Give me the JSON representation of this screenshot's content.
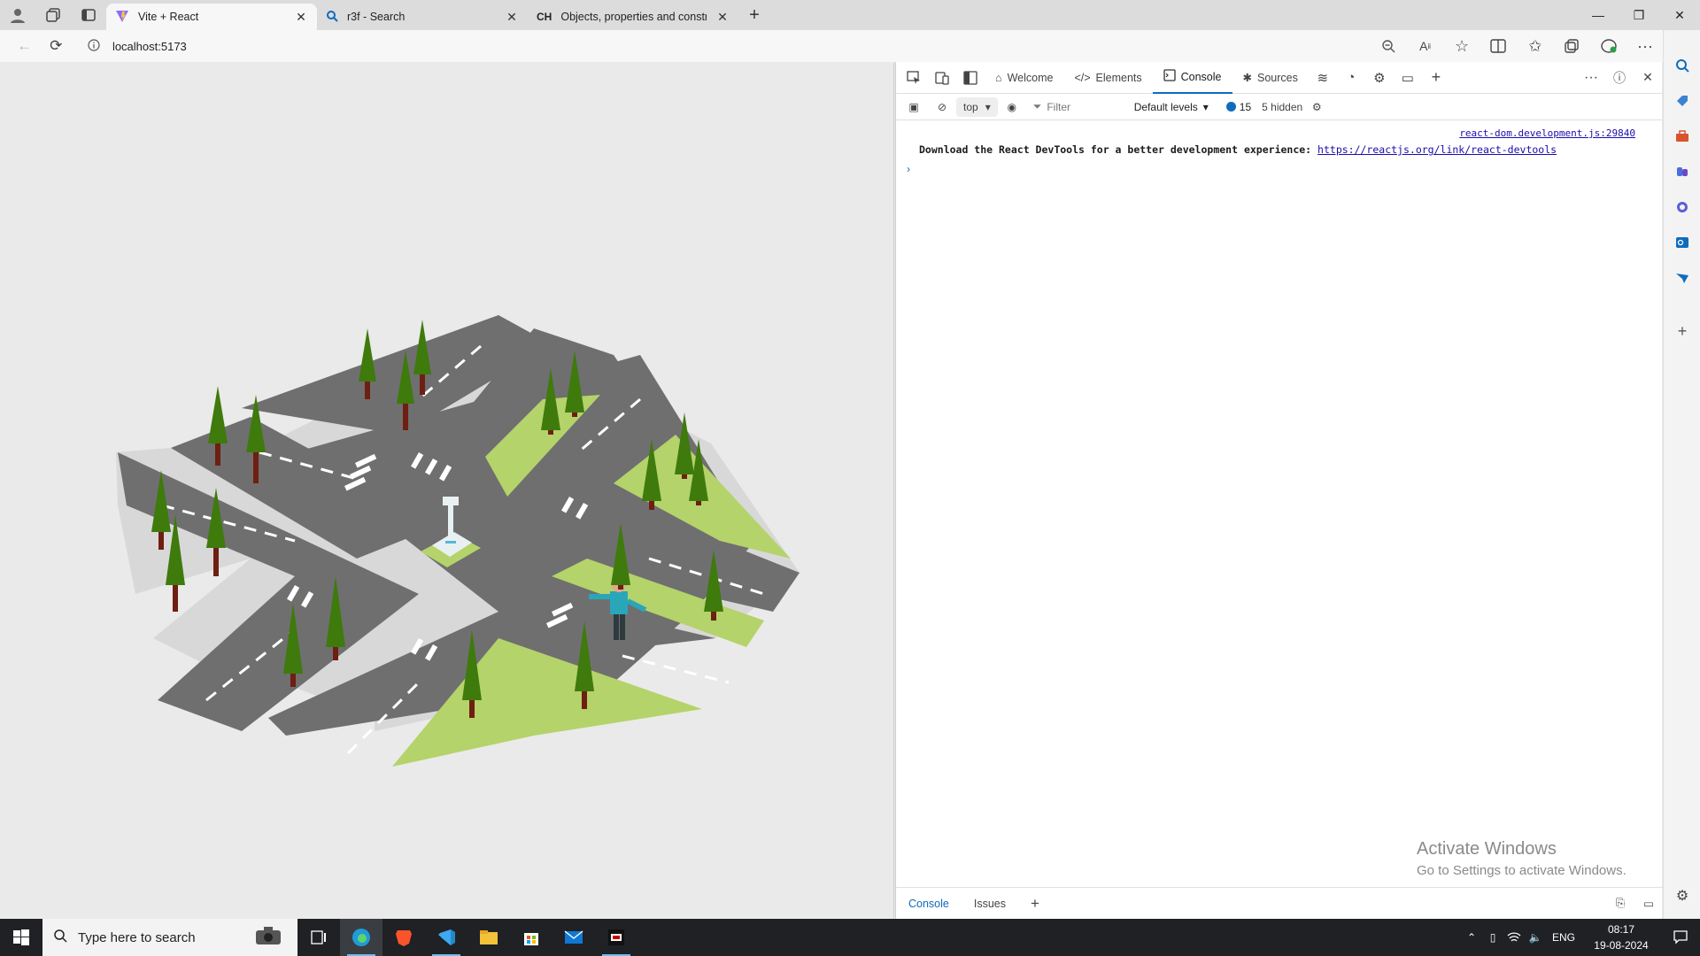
{
  "browser": {
    "tabs": [
      {
        "title": "Vite + React",
        "active": true
      },
      {
        "title": "r3f - Search",
        "active": false
      },
      {
        "title": "Objects, properties and construc",
        "prefix": "CH",
        "active": false
      }
    ],
    "address": {
      "url": "localhost:5173"
    }
  },
  "devtools": {
    "tabs": [
      "Welcome",
      "Elements",
      "Console",
      "Sources"
    ],
    "active_tab": "Console",
    "context": "top",
    "filter_placeholder": "Filter",
    "levels": "Default levels",
    "message_count": "15",
    "hidden": "5 hidden",
    "source_link": "react-dom.development.js:29840",
    "log_text": "Download the React DevTools for a better development experience: ",
    "log_link": "https://reactjs.org/link/react-devtools",
    "drawer_tabs": [
      "Console",
      "Issues"
    ]
  },
  "watermark": {
    "title": "Activate Windows",
    "subtitle": "Go to Settings to activate Windows."
  },
  "taskbar": {
    "search_placeholder": "Type here to search",
    "language": "ENG",
    "time": "08:17",
    "date": "19-08-2024"
  },
  "colors": {
    "accent": "#0f6cbd",
    "road": "#6f6f70",
    "grass": "#b4d36a",
    "curb": "#d4d4d4",
    "tree_leaf": "#3f7a0c",
    "tree_trunk": "#6e1f12"
  },
  "scene": {
    "description_icons": [
      "trees",
      "roads",
      "crosswalks",
      "fountain",
      "character"
    ]
  }
}
